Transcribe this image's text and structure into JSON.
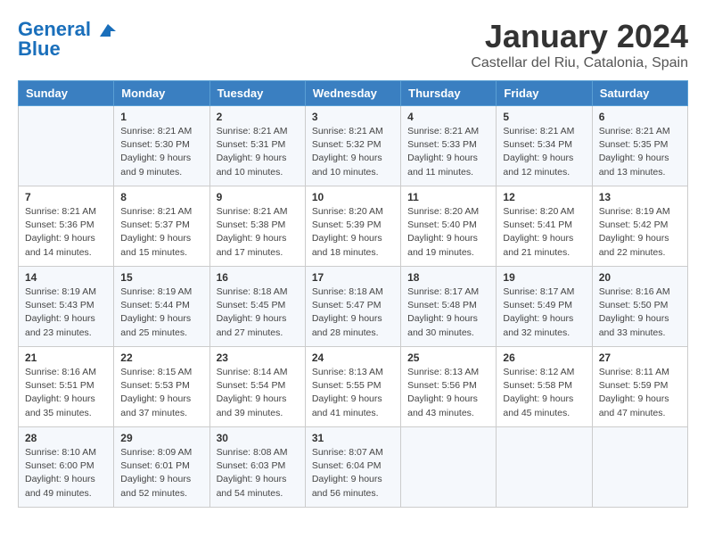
{
  "header": {
    "logo_line1": "General",
    "logo_line2": "Blue",
    "month_title": "January 2024",
    "location": "Castellar del Riu, Catalonia, Spain"
  },
  "days_of_week": [
    "Sunday",
    "Monday",
    "Tuesday",
    "Wednesday",
    "Thursday",
    "Friday",
    "Saturday"
  ],
  "weeks": [
    [
      {
        "day": "",
        "sunrise": "",
        "sunset": "",
        "daylight": ""
      },
      {
        "day": "1",
        "sunrise": "Sunrise: 8:21 AM",
        "sunset": "Sunset: 5:30 PM",
        "daylight": "Daylight: 9 hours and 9 minutes."
      },
      {
        "day": "2",
        "sunrise": "Sunrise: 8:21 AM",
        "sunset": "Sunset: 5:31 PM",
        "daylight": "Daylight: 9 hours and 10 minutes."
      },
      {
        "day": "3",
        "sunrise": "Sunrise: 8:21 AM",
        "sunset": "Sunset: 5:32 PM",
        "daylight": "Daylight: 9 hours and 10 minutes."
      },
      {
        "day": "4",
        "sunrise": "Sunrise: 8:21 AM",
        "sunset": "Sunset: 5:33 PM",
        "daylight": "Daylight: 9 hours and 11 minutes."
      },
      {
        "day": "5",
        "sunrise": "Sunrise: 8:21 AM",
        "sunset": "Sunset: 5:34 PM",
        "daylight": "Daylight: 9 hours and 12 minutes."
      },
      {
        "day": "6",
        "sunrise": "Sunrise: 8:21 AM",
        "sunset": "Sunset: 5:35 PM",
        "daylight": "Daylight: 9 hours and 13 minutes."
      }
    ],
    [
      {
        "day": "7",
        "sunrise": "Sunrise: 8:21 AM",
        "sunset": "Sunset: 5:36 PM",
        "daylight": "Daylight: 9 hours and 14 minutes."
      },
      {
        "day": "8",
        "sunrise": "Sunrise: 8:21 AM",
        "sunset": "Sunset: 5:37 PM",
        "daylight": "Daylight: 9 hours and 15 minutes."
      },
      {
        "day": "9",
        "sunrise": "Sunrise: 8:21 AM",
        "sunset": "Sunset: 5:38 PM",
        "daylight": "Daylight: 9 hours and 17 minutes."
      },
      {
        "day": "10",
        "sunrise": "Sunrise: 8:20 AM",
        "sunset": "Sunset: 5:39 PM",
        "daylight": "Daylight: 9 hours and 18 minutes."
      },
      {
        "day": "11",
        "sunrise": "Sunrise: 8:20 AM",
        "sunset": "Sunset: 5:40 PM",
        "daylight": "Daylight: 9 hours and 19 minutes."
      },
      {
        "day": "12",
        "sunrise": "Sunrise: 8:20 AM",
        "sunset": "Sunset: 5:41 PM",
        "daylight": "Daylight: 9 hours and 21 minutes."
      },
      {
        "day": "13",
        "sunrise": "Sunrise: 8:19 AM",
        "sunset": "Sunset: 5:42 PM",
        "daylight": "Daylight: 9 hours and 22 minutes."
      }
    ],
    [
      {
        "day": "14",
        "sunrise": "Sunrise: 8:19 AM",
        "sunset": "Sunset: 5:43 PM",
        "daylight": "Daylight: 9 hours and 23 minutes."
      },
      {
        "day": "15",
        "sunrise": "Sunrise: 8:19 AM",
        "sunset": "Sunset: 5:44 PM",
        "daylight": "Daylight: 9 hours and 25 minutes."
      },
      {
        "day": "16",
        "sunrise": "Sunrise: 8:18 AM",
        "sunset": "Sunset: 5:45 PM",
        "daylight": "Daylight: 9 hours and 27 minutes."
      },
      {
        "day": "17",
        "sunrise": "Sunrise: 8:18 AM",
        "sunset": "Sunset: 5:47 PM",
        "daylight": "Daylight: 9 hours and 28 minutes."
      },
      {
        "day": "18",
        "sunrise": "Sunrise: 8:17 AM",
        "sunset": "Sunset: 5:48 PM",
        "daylight": "Daylight: 9 hours and 30 minutes."
      },
      {
        "day": "19",
        "sunrise": "Sunrise: 8:17 AM",
        "sunset": "Sunset: 5:49 PM",
        "daylight": "Daylight: 9 hours and 32 minutes."
      },
      {
        "day": "20",
        "sunrise": "Sunrise: 8:16 AM",
        "sunset": "Sunset: 5:50 PM",
        "daylight": "Daylight: 9 hours and 33 minutes."
      }
    ],
    [
      {
        "day": "21",
        "sunrise": "Sunrise: 8:16 AM",
        "sunset": "Sunset: 5:51 PM",
        "daylight": "Daylight: 9 hours and 35 minutes."
      },
      {
        "day": "22",
        "sunrise": "Sunrise: 8:15 AM",
        "sunset": "Sunset: 5:53 PM",
        "daylight": "Daylight: 9 hours and 37 minutes."
      },
      {
        "day": "23",
        "sunrise": "Sunrise: 8:14 AM",
        "sunset": "Sunset: 5:54 PM",
        "daylight": "Daylight: 9 hours and 39 minutes."
      },
      {
        "day": "24",
        "sunrise": "Sunrise: 8:13 AM",
        "sunset": "Sunset: 5:55 PM",
        "daylight": "Daylight: 9 hours and 41 minutes."
      },
      {
        "day": "25",
        "sunrise": "Sunrise: 8:13 AM",
        "sunset": "Sunset: 5:56 PM",
        "daylight": "Daylight: 9 hours and 43 minutes."
      },
      {
        "day": "26",
        "sunrise": "Sunrise: 8:12 AM",
        "sunset": "Sunset: 5:58 PM",
        "daylight": "Daylight: 9 hours and 45 minutes."
      },
      {
        "day": "27",
        "sunrise": "Sunrise: 8:11 AM",
        "sunset": "Sunset: 5:59 PM",
        "daylight": "Daylight: 9 hours and 47 minutes."
      }
    ],
    [
      {
        "day": "28",
        "sunrise": "Sunrise: 8:10 AM",
        "sunset": "Sunset: 6:00 PM",
        "daylight": "Daylight: 9 hours and 49 minutes."
      },
      {
        "day": "29",
        "sunrise": "Sunrise: 8:09 AM",
        "sunset": "Sunset: 6:01 PM",
        "daylight": "Daylight: 9 hours and 52 minutes."
      },
      {
        "day": "30",
        "sunrise": "Sunrise: 8:08 AM",
        "sunset": "Sunset: 6:03 PM",
        "daylight": "Daylight: 9 hours and 54 minutes."
      },
      {
        "day": "31",
        "sunrise": "Sunrise: 8:07 AM",
        "sunset": "Sunset: 6:04 PM",
        "daylight": "Daylight: 9 hours and 56 minutes."
      },
      {
        "day": "",
        "sunrise": "",
        "sunset": "",
        "daylight": ""
      },
      {
        "day": "",
        "sunrise": "",
        "sunset": "",
        "daylight": ""
      },
      {
        "day": "",
        "sunrise": "",
        "sunset": "",
        "daylight": ""
      }
    ]
  ]
}
